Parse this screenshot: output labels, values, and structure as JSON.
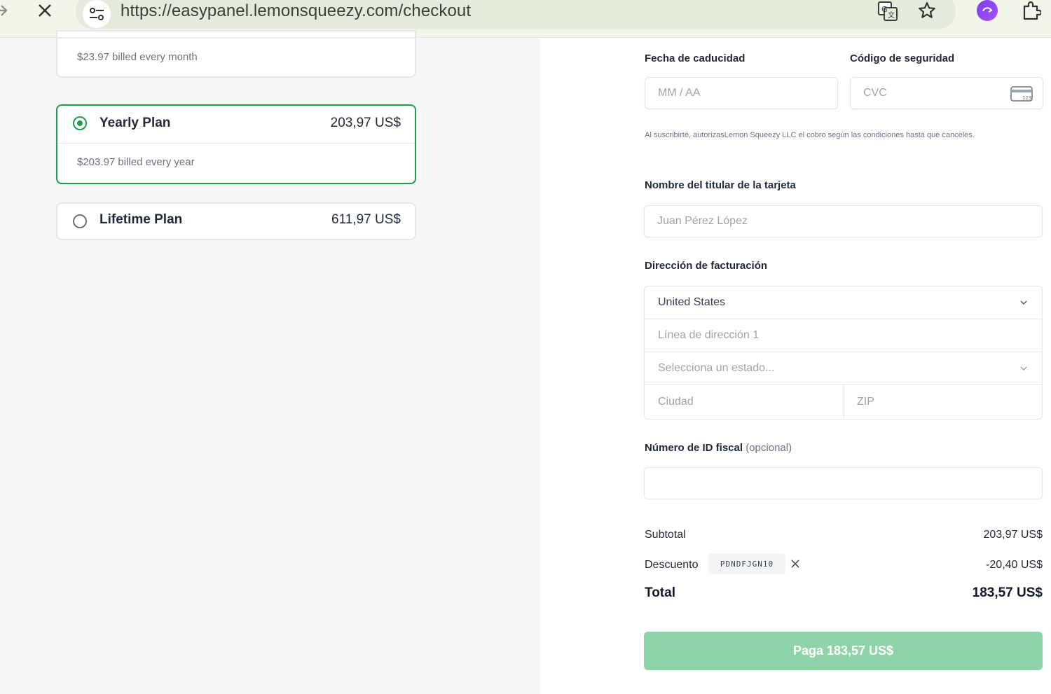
{
  "browser": {
    "url": "https://easypanel.lemonsqueezy.com/checkout",
    "icons": [
      "forward-arrow-icon",
      "close-icon",
      "site-info-icon",
      "translate-icon",
      "star-icon",
      "extension-icon",
      "puzzle-icon"
    ]
  },
  "plans": {
    "monthly": {
      "sub": "$23.97 billed every month"
    },
    "yearly": {
      "name": "Yearly Plan",
      "price": "203,97 US$",
      "sub": "$203.97 billed every year",
      "selected": true
    },
    "lifetime": {
      "name": "Lifetime Plan",
      "price": "611,97 US$",
      "selected": false
    }
  },
  "form": {
    "expiry_label": "Fecha de caducidad",
    "expiry_placeholder": "MM / AA",
    "cvc_label": "Código de seguridad",
    "cvc_placeholder": "CVC",
    "terms": "Al suscribirte, autorizasLemon Squeezy LLC el cobro según las condiciones hasta que canceles.",
    "cardholder_label": "Nombre del titular de la tarjeta",
    "cardholder_placeholder": "Juan Pérez López",
    "billing_label": "Dirección de facturación",
    "country_value": "United States",
    "address_placeholder": "Línea de dirección 1",
    "state_placeholder": "Selecciona un estado...",
    "city_placeholder": "Ciudad",
    "zip_placeholder": "ZIP",
    "tax_label": "Número de ID fiscal",
    "tax_optional": "(opcional)"
  },
  "summary": {
    "subtotal_label": "Subtotal",
    "subtotal_value": "203,97 US$",
    "discount_label": "Descuento",
    "coupon_code": "PDNDFJGN10",
    "discount_value": "-20,40 US$",
    "total_label": "Total",
    "total_value": "183,57 US$"
  },
  "pay_button": "Paga 183,57 US$",
  "colors": {
    "accent": "#1f9e4d",
    "pay_button": "#8fd4a9",
    "left_bg": "#f6f6f6"
  }
}
